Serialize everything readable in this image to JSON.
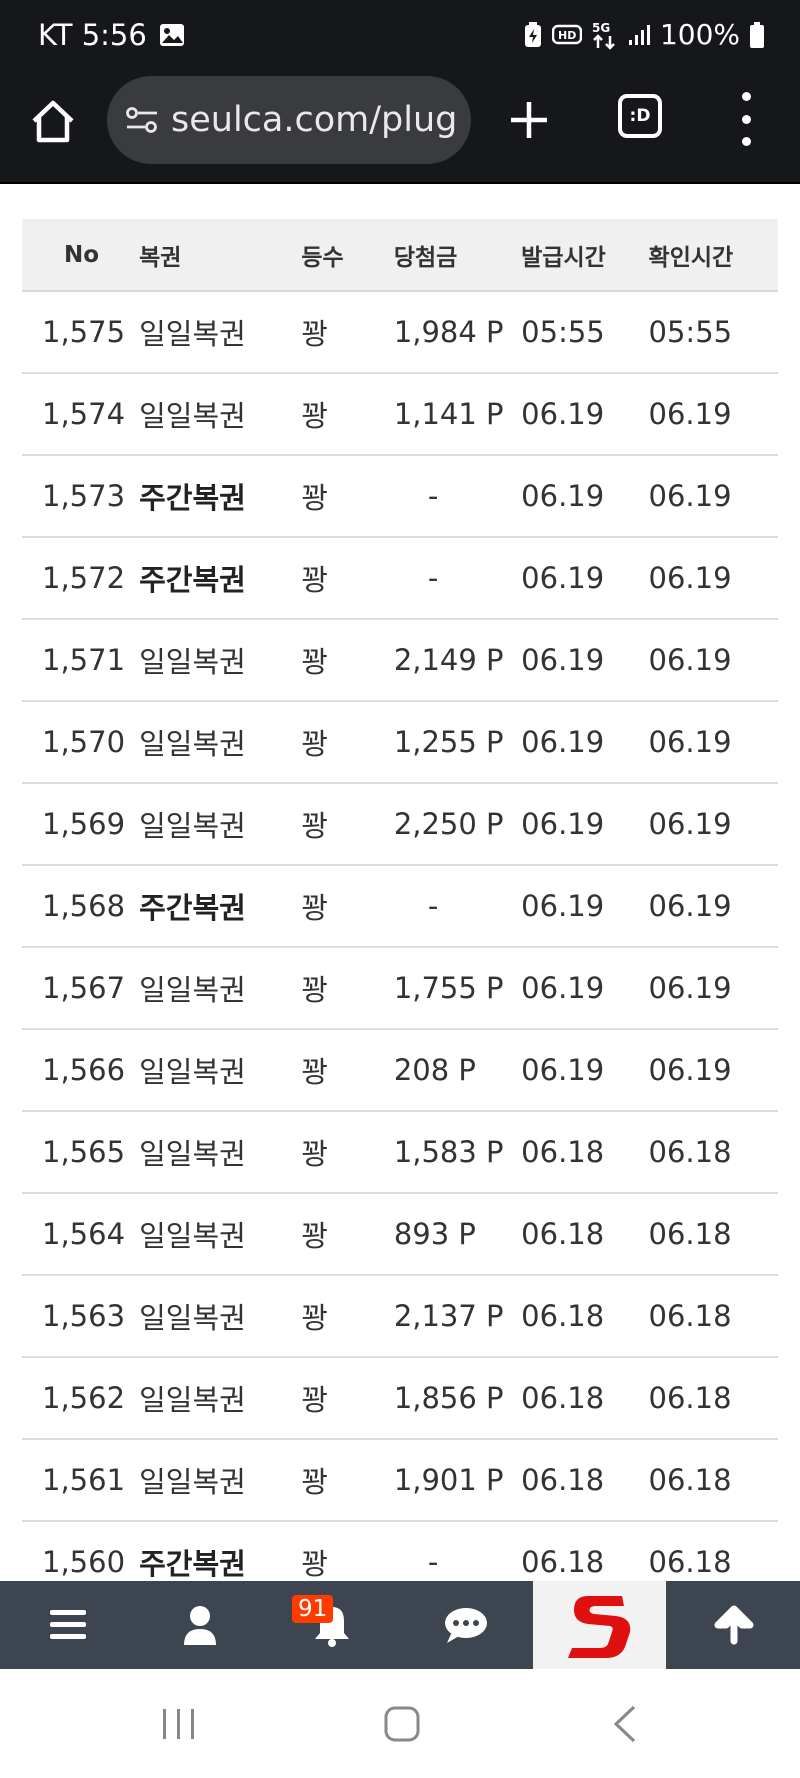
{
  "status_bar": {
    "carrier_time": "KT 5:56",
    "network": "5G",
    "battery": "100%"
  },
  "browser": {
    "url": "seulca.com/plug"
  },
  "table": {
    "headers": [
      "No",
      "복권",
      "등수",
      "당첨금",
      "발급시간",
      "확인시간"
    ],
    "rows": [
      {
        "no": "1,575",
        "type": "일일복권",
        "rank": "꽝",
        "prize": "1,984 P",
        "issued": "05:55",
        "checked": "05:55"
      },
      {
        "no": "1,574",
        "type": "일일복권",
        "rank": "꽝",
        "prize": "1,141 P",
        "issued": "06.19",
        "checked": "06.19"
      },
      {
        "no": "1,573",
        "type": "주간복권",
        "rank": "꽝",
        "prize": "-",
        "issued": "06.19",
        "checked": "06.19"
      },
      {
        "no": "1,572",
        "type": "주간복권",
        "rank": "꽝",
        "prize": "-",
        "issued": "06.19",
        "checked": "06.19"
      },
      {
        "no": "1,571",
        "type": "일일복권",
        "rank": "꽝",
        "prize": "2,149 P",
        "issued": "06.19",
        "checked": "06.19"
      },
      {
        "no": "1,570",
        "type": "일일복권",
        "rank": "꽝",
        "prize": "1,255 P",
        "issued": "06.19",
        "checked": "06.19"
      },
      {
        "no": "1,569",
        "type": "일일복권",
        "rank": "꽝",
        "prize": "2,250 P",
        "issued": "06.19",
        "checked": "06.19"
      },
      {
        "no": "1,568",
        "type": "주간복권",
        "rank": "꽝",
        "prize": "-",
        "issued": "06.19",
        "checked": "06.19"
      },
      {
        "no": "1,567",
        "type": "일일복권",
        "rank": "꽝",
        "prize": "1,755 P",
        "issued": "06.19",
        "checked": "06.19"
      },
      {
        "no": "1,566",
        "type": "일일복권",
        "rank": "꽝",
        "prize": "208 P",
        "issued": "06.19",
        "checked": "06.19"
      },
      {
        "no": "1,565",
        "type": "일일복권",
        "rank": "꽝",
        "prize": "1,583 P",
        "issued": "06.18",
        "checked": "06.18"
      },
      {
        "no": "1,564",
        "type": "일일복권",
        "rank": "꽝",
        "prize": "893 P",
        "issued": "06.18",
        "checked": "06.18"
      },
      {
        "no": "1,563",
        "type": "일일복권",
        "rank": "꽝",
        "prize": "2,137 P",
        "issued": "06.18",
        "checked": "06.18"
      },
      {
        "no": "1,562",
        "type": "일일복권",
        "rank": "꽝",
        "prize": "1,856 P",
        "issued": "06.18",
        "checked": "06.18"
      },
      {
        "no": "1,561",
        "type": "일일복권",
        "rank": "꽝",
        "prize": "1,901 P",
        "issued": "06.18",
        "checked": "06.18"
      },
      {
        "no": "1,560",
        "type": "주간복권",
        "rank": "꽝",
        "prize": "-",
        "issued": "06.18",
        "checked": "06.18"
      }
    ]
  },
  "bottom_nav": {
    "notification_count": "91",
    "items": [
      "menu-icon",
      "user-icon",
      "bell-icon",
      "chat-icon",
      "site-logo",
      "scroll-top-icon"
    ]
  },
  "colors": {
    "status_bg": "#16171b",
    "nav_bg": "#3d4550",
    "badge": "#ff3b00",
    "logo_red": "#e01010"
  }
}
